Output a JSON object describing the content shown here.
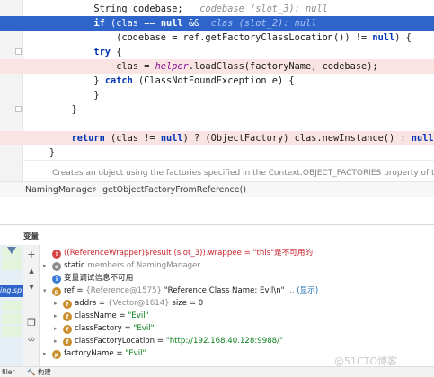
{
  "editor": {
    "lines": [
      {
        "indent": "            ",
        "parts": [
          [
            "plain",
            "String codebase;   "
          ],
          [
            "hint",
            "codebase (slot_3): null"
          ]
        ],
        "hl": "",
        "bp": false
      },
      {
        "indent": "            ",
        "parts": [
          [
            "kw",
            "if"
          ],
          [
            "plain",
            " (clas == "
          ],
          [
            "kw",
            "null"
          ],
          [
            "plain",
            " &&  "
          ],
          [
            "hint",
            "clas (slot_2): null"
          ]
        ],
        "hl": "exec",
        "bp": false
      },
      {
        "indent": "                ",
        "parts": [
          [
            "plain",
            "(codebase = ref.getFactoryClassLocation()) != "
          ],
          [
            "kw",
            "null"
          ],
          [
            "plain",
            ") {"
          ]
        ],
        "hl": "",
        "bp": false
      },
      {
        "indent": "            ",
        "parts": [
          [
            "kw",
            "try"
          ],
          [
            "plain",
            " {"
          ]
        ],
        "hl": "",
        "bp": false
      },
      {
        "indent": "                ",
        "parts": [
          [
            "plain",
            "clas = "
          ],
          [
            "field",
            "helper"
          ],
          [
            "plain",
            ".loadClass(factoryName, codebase);"
          ]
        ],
        "hl": "bp",
        "bp": true
      },
      {
        "indent": "            ",
        "parts": [
          [
            "plain",
            "} "
          ],
          [
            "kw",
            "catch"
          ],
          [
            "plain",
            " (ClassNotFoundException e) {"
          ]
        ],
        "hl": "",
        "bp": false
      },
      {
        "indent": "            ",
        "parts": [
          [
            "plain",
            "}"
          ]
        ],
        "hl": "",
        "bp": false
      },
      {
        "indent": "        ",
        "parts": [
          [
            "plain",
            "}"
          ]
        ],
        "hl": "",
        "bp": false
      },
      {
        "indent": "",
        "parts": [],
        "hl": "",
        "bp": false
      },
      {
        "indent": "        ",
        "parts": [
          [
            "kw",
            "return"
          ],
          [
            "plain",
            " (clas != "
          ],
          [
            "kw",
            "null"
          ],
          [
            "plain",
            ") ? (ObjectFactory) clas.newInstance() : "
          ],
          [
            "kw",
            "null"
          ],
          [
            "plain",
            ";"
          ]
        ],
        "hl": "bp",
        "bp": true
      },
      {
        "indent": "    ",
        "parts": [
          [
            "plain",
            "}"
          ]
        ],
        "hl": "",
        "bp": false
      }
    ],
    "doc_comment": "Creates an object using the factories specified in the Context.OBJECT_FACTORIES property of the"
  },
  "breadcrumb": {
    "items": [
      "NamingManager",
      "getObjectFactoryFromReference()"
    ],
    "separator": "›"
  },
  "debug": {
    "panel_title": "变量",
    "frame_snippet": "ing.sp",
    "variables": [
      {
        "expand": "",
        "badge": "err",
        "badge_text": "!",
        "parts": [
          [
            "v-red",
            "((ReferenceWrapper)$result (slot_3)).wrappee = \"this\"是不可用的"
          ]
        ]
      },
      {
        "expand": "▸",
        "badge": "s",
        "badge_text": "s",
        "parts": [
          [
            "plain",
            "static "
          ],
          [
            "v-gray",
            "members of NamingManager"
          ]
        ]
      },
      {
        "expand": "",
        "badge": "info",
        "badge_text": "i",
        "parts": [
          [
            "plain",
            "变量调试信息不可用"
          ]
        ]
      },
      {
        "expand": "▾",
        "badge": "p",
        "badge_text": "p",
        "parts": [
          [
            "plain",
            "ref = "
          ],
          [
            "v-gray",
            "{Reference@1575} "
          ],
          [
            "plain",
            "\"Reference Class Name: Evil\\n\""
          ],
          [
            "v-gray",
            " ... "
          ],
          [
            "v-blue",
            "(显示)"
          ]
        ]
      },
      {
        "expand": "▸",
        "badge": "f",
        "badge_text": "f",
        "sub": true,
        "parts": [
          [
            "plain",
            "addrs = "
          ],
          [
            "v-gray",
            "{Vector@1614} "
          ],
          [
            "plain",
            " size = 0"
          ]
        ]
      },
      {
        "expand": "▸",
        "badge": "f",
        "badge_text": "f",
        "sub": true,
        "parts": [
          [
            "plain",
            "className = "
          ],
          [
            "v-str",
            "\"Evil\""
          ]
        ]
      },
      {
        "expand": "▸",
        "badge": "f",
        "badge_text": "f",
        "sub": true,
        "parts": [
          [
            "plain",
            "classFactory = "
          ],
          [
            "v-str",
            "\"Evil\""
          ]
        ]
      },
      {
        "expand": "▸",
        "badge": "f",
        "badge_text": "f",
        "sub": true,
        "parts": [
          [
            "plain",
            "classFactoryLocation = "
          ],
          [
            "v-str",
            "\"http://192.168.40.128:9988/\""
          ]
        ]
      },
      {
        "expand": "▸",
        "badge": "p",
        "badge_text": "p",
        "parts": [
          [
            "plain",
            "factoryName = "
          ],
          [
            "v-str",
            "\"Evil\""
          ]
        ]
      }
    ]
  },
  "statusbar": {
    "items": [
      "filer",
      "构建"
    ]
  },
  "watermark": "@51CTO博客",
  "colors": {
    "exec_highlight": "#2f65ca",
    "breakpoint_line": "#fae3e3",
    "keyword": "#0033b3",
    "error_text": "#c7222a",
    "string_value": "#067d17"
  }
}
